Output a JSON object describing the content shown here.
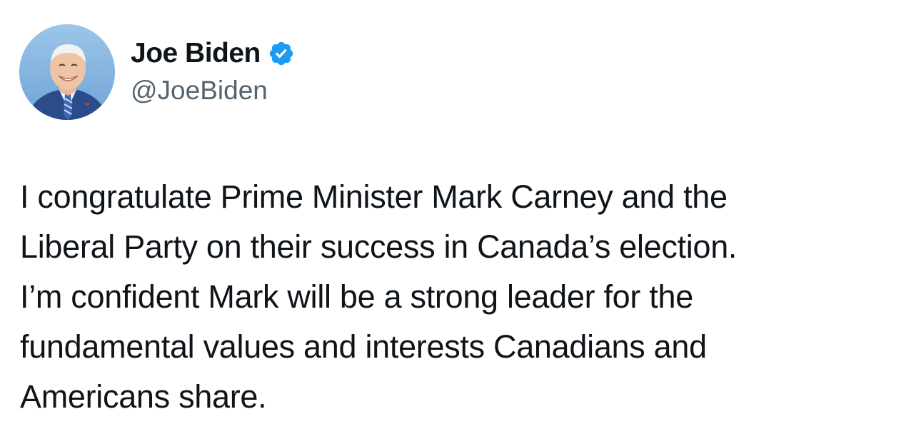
{
  "author": {
    "display_name": "Joe Biden",
    "handle": "@JoeBiden",
    "avatar_icon": "profile-photo",
    "verified_icon": "verified-badge-icon",
    "verified_color": "#1d9bf0"
  },
  "tweet": {
    "lines": [
      "I congratulate Prime Minister Mark Carney and the",
      "Liberal Party on their success in Canada’s election.",
      "I’m confident Mark will be a strong leader for the",
      "fundamental values and interests Canadians and",
      "Americans share."
    ]
  },
  "colors": {
    "text_primary": "#0f1419",
    "text_secondary": "#536471",
    "background": "#ffffff"
  }
}
